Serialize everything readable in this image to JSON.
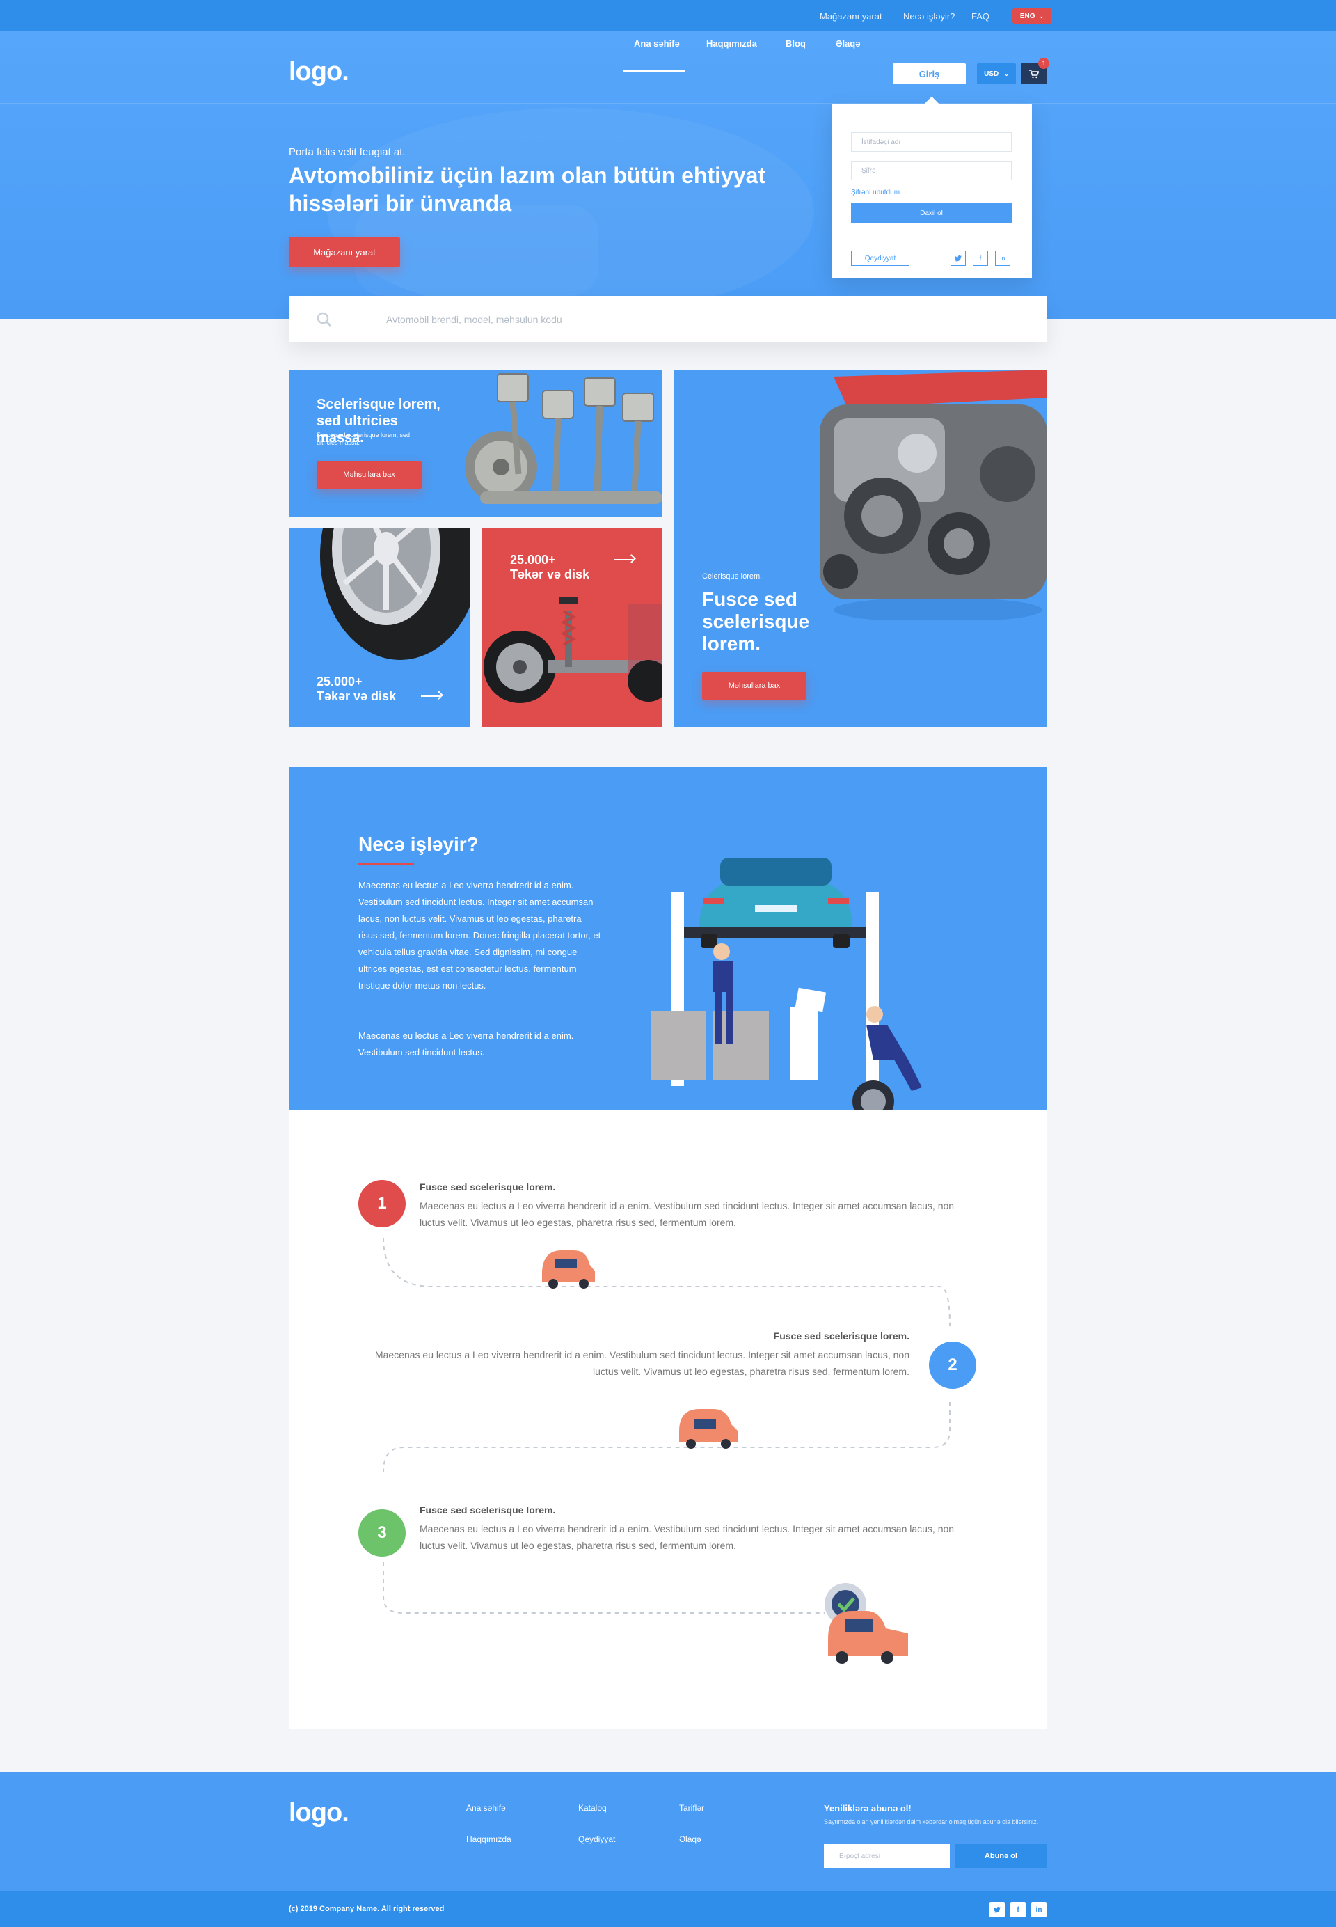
{
  "topbar": {
    "create_store": "Mağazanı yarat",
    "how_it_works": "Necə işləyir?",
    "faq": "FAQ",
    "lang": "ENG"
  },
  "header": {
    "logo": "logo.",
    "nav": [
      "Ana səhifə",
      "Haqqımızda",
      "Bloq",
      "Əlaqə"
    ],
    "login": "Giriş",
    "currency": "USD",
    "cart_count": "1"
  },
  "login_dropdown": {
    "username_placeholder": "İstifadəçi adı",
    "password_placeholder": "Şifrə",
    "forgot": "Şifrəni unutdum",
    "submit": "Daxil ol",
    "register": "Qeydiyyat",
    "social": [
      "t",
      "f",
      "in"
    ]
  },
  "hero": {
    "small": "Porta felis velit feugiat at.",
    "title": "Avtomobiliniz üçün lazım olan bütün ehtiyyat hissələri bir ünvanda",
    "cta": "Mağazanı yarat"
  },
  "search": {
    "placeholder": "Avtomobil brendi, model, məhsulun kodu"
  },
  "promo": {
    "card1": {
      "title": "Scelerisque lorem, sed ultricies massa.",
      "sub": "Fusce sed scelerisque lorem, sed ultricies massa.",
      "btn": "Məhsullara bax"
    },
    "card2": {
      "count": "25.000+",
      "label": "Təkər və disk"
    },
    "card3": {
      "count": "25.000+",
      "label": "Təkər və disk"
    },
    "card4": {
      "small": "Celerisque lorem.",
      "title": "Fusce sed scelerisque lorem.",
      "btn": "Məhsullara bax"
    }
  },
  "how": {
    "title": "Necə işləyir?",
    "p1": "Maecenas eu lectus a Leo viverra hendrerit id a enim. Vestibulum sed tincidunt lectus. Integer sit amet accumsan lacus, non luctus velit. Vivamus ut leo egestas, pharetra risus sed, fermentum lorem. Donec fringilla placerat tortor, et vehicula tellus gravida vitae. Sed dignissim, mi congue ultrices egestas, est est consectetur lectus, fermentum tristique dolor metus non lectus.",
    "p2": "Maecenas eu lectus a Leo viverra hendrerit id a enim. Vestibulum sed tincidunt lectus."
  },
  "steps": [
    {
      "num": "1",
      "title": "Fusce sed scelerisque lorem.",
      "text": "Maecenas eu lectus a Leo viverra hendrerit id a enim. Vestibulum sed tincidunt lectus. Integer sit amet accumsan lacus, non luctus velit. Vivamus ut leo egestas, pharetra risus sed, fermentum lorem.",
      "color": "#e04b4b"
    },
    {
      "num": "2",
      "title": "Fusce sed scelerisque lorem.",
      "text": "Maecenas eu lectus a Leo viverra hendrerit id a enim. Vestibulum sed tincidunt lectus. Integer sit amet accumsan lacus, non luctus velit. Vivamus ut leo egestas, pharetra risus sed, fermentum lorem.",
      "color": "#4a9cf5"
    },
    {
      "num": "3",
      "title": "Fusce sed scelerisque lorem.",
      "text": "Maecenas eu lectus a Leo viverra hendrerit id a enim. Vestibulum sed tincidunt lectus. Integer sit amet accumsan lacus, non luctus velit. Vivamus ut leo egestas, pharetra risus sed, fermentum lorem.",
      "color": "#6cc36a"
    }
  ],
  "footer": {
    "logo": "logo.",
    "links": [
      "Ana səhifə",
      "Kataloq",
      "Tariflər",
      "Haqqımızda",
      "Qeydiyyat",
      "Əlaqə"
    ],
    "newsletter_title": "Yeniliklərə abunə ol!",
    "newsletter_text": "Saytımızda olan yeniliklərdən daim xəbərdar olmaq üçün abunə ola bilərsiniz.",
    "email_placeholder": "E-poçt adresi",
    "subscribe": "Abunə ol",
    "copyright": "(c) 2019 Company Name. All right reserved",
    "social": [
      "t",
      "f",
      "in"
    ]
  },
  "colors": {
    "primary": "#4a9cf5",
    "dark_blue": "#2f8eea",
    "red": "#e04b4b",
    "green": "#6cc36a",
    "navy": "#23395d"
  }
}
